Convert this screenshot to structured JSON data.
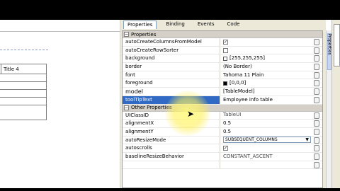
{
  "design": {
    "table": {
      "header": "Title 4"
    }
  },
  "panel": {
    "tabs": [
      {
        "label": "Properties",
        "active": true
      },
      {
        "label": "Binding",
        "active": false
      },
      {
        "label": "Events",
        "active": false
      },
      {
        "label": "Code",
        "active": false
      }
    ],
    "categories": {
      "properties": "Properties",
      "other": "Other Properties"
    },
    "properties": [
      {
        "name": "autoCreateColumnsFromModel",
        "value": "",
        "type": "checkbox",
        "checked": true
      },
      {
        "name": "autoCreateRowSorter",
        "value": "",
        "type": "checkbox",
        "checked": false
      },
      {
        "name": "background",
        "value": "[255,255,255]",
        "type": "color",
        "color": "#ffffff"
      },
      {
        "name": "border",
        "value": "(No Border)",
        "type": "text"
      },
      {
        "name": "font",
        "value": "Tahoma 11 Plain",
        "type": "text"
      },
      {
        "name": "foreground",
        "value": "[0,0,0]",
        "type": "color",
        "color": "#000000"
      },
      {
        "name": "model",
        "value": "[TableModel]",
        "type": "text"
      },
      {
        "name": "toolTipText",
        "value": "Employee info table",
        "type": "text",
        "selected": true
      }
    ],
    "other_properties": [
      {
        "name": "UIClassID",
        "value": "TableUI",
        "type": "readonly"
      },
      {
        "name": "alignmentX",
        "value": "0.5",
        "type": "text"
      },
      {
        "name": "alignmentY",
        "value": "0.5",
        "type": "text"
      },
      {
        "name": "autoResizeMode",
        "value": "SUBSEQUENT_COLUMNS",
        "type": "select"
      },
      {
        "name": "autoscrolls",
        "value": "",
        "type": "checkbox",
        "checked": true
      },
      {
        "name": "baselineResizeBehavior",
        "value": "CONSTANT_ASCENT",
        "type": "readonly"
      }
    ]
  },
  "sidebar": {
    "tab_label": "Properties"
  }
}
